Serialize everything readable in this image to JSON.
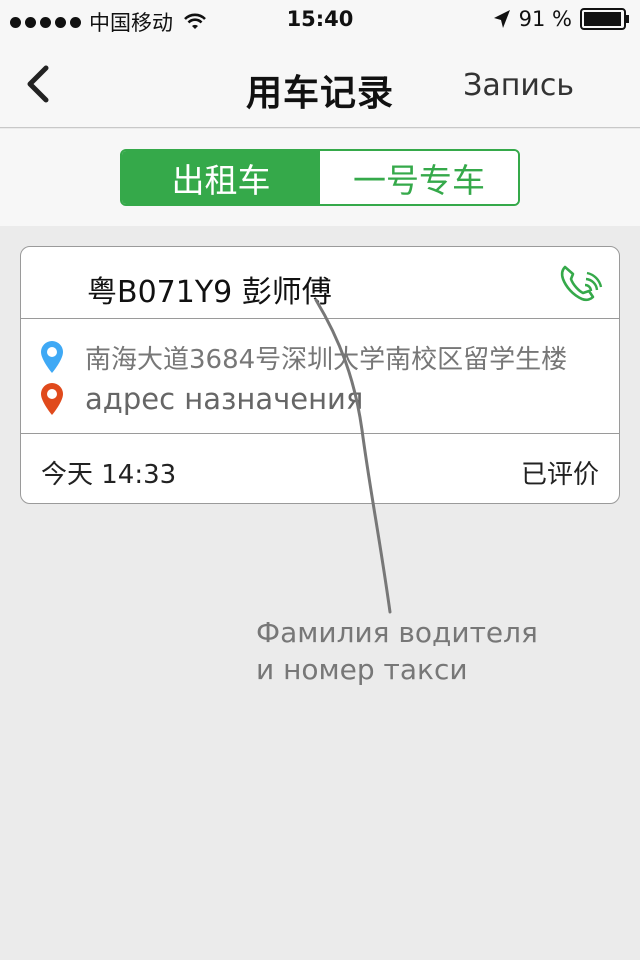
{
  "status_bar": {
    "carrier": "中国移动",
    "time": "15:40",
    "battery": "91 %"
  },
  "nav": {
    "title": "用车记录",
    "right_label": "Запись"
  },
  "segment": {
    "items": [
      {
        "label": "出租车",
        "selected": true
      },
      {
        "label": "一号专车",
        "selected": false
      }
    ]
  },
  "record": {
    "driver": "粤B071Y9 彭师傅",
    "from": "南海大道3684号深圳大学南校区留学生楼",
    "to": "адрес назначения",
    "time": "今天 14:33",
    "status": "已评价"
  },
  "annotation": {
    "line1": "Фамилия водителя",
    "line2": "и номер такси"
  },
  "colors": {
    "accent": "#35a94a",
    "from_pin": "#3fa9f5",
    "to_pin": "#e04a1c"
  },
  "icons": [
    "back-arrow-icon",
    "wifi-icon",
    "location-arrow-icon",
    "battery-icon",
    "phone-icon",
    "pin-icon"
  ]
}
